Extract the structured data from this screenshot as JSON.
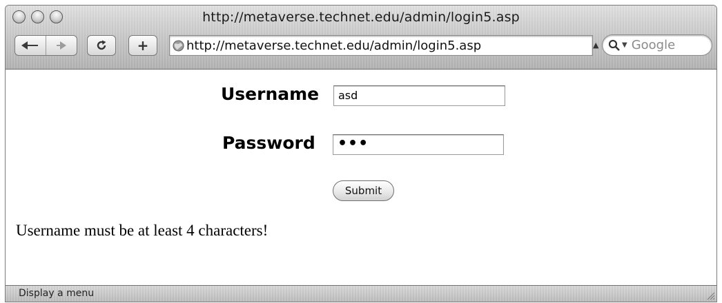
{
  "window": {
    "title": "http://metaverse.technet.edu/admin/login5.asp"
  },
  "toolbar": {
    "back_icon": "back-arrow-icon",
    "forward_icon": "forward-arrow-icon",
    "reload_icon": "reload-icon",
    "add_bookmark_label": "+",
    "url": "http://metaverse.technet.edu/admin/login5.asp",
    "search_placeholder": "Google"
  },
  "form": {
    "username_label": "Username",
    "username_value": "asd",
    "password_label": "Password",
    "password_value": "•••",
    "submit_label": "Submit"
  },
  "message": {
    "error_text": "Username must be at least 4 characters!"
  },
  "statusbar": {
    "text": "Display a menu"
  }
}
